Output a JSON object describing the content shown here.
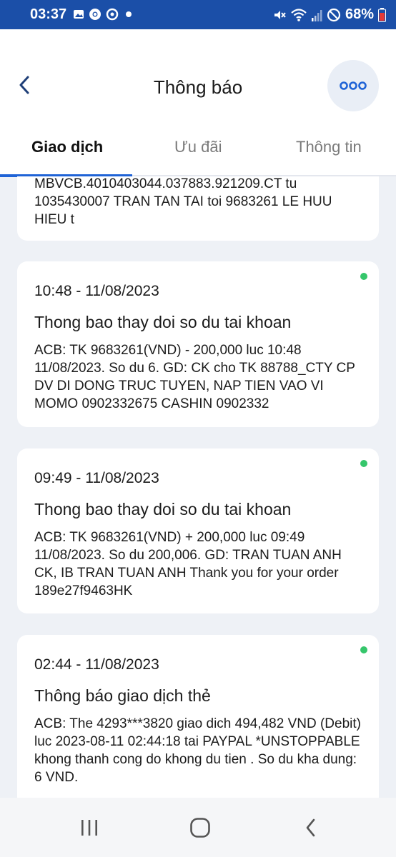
{
  "status_bar": {
    "time": "03:37",
    "battery": "68%",
    "icons_left": [
      "gallery-icon",
      "chrome-icon",
      "sync-icon",
      "dot-icon"
    ],
    "icons_right": [
      "mute-icon",
      "wifi-icon",
      "signal-icon",
      "dnd-icon",
      "battery-icon"
    ]
  },
  "header": {
    "title": "Thông báo"
  },
  "tabs": [
    {
      "label": "Giao dịch",
      "active": true
    },
    {
      "label": "Ưu đãi",
      "active": false
    },
    {
      "label": "Thông tin",
      "active": false
    }
  ],
  "notifications": [
    {
      "partial": true,
      "body": "MBVCB.4010403044.037883.921209.CT tu 1035430007 TRAN TAN TAI toi 9683261 LE HUU HIEU t"
    },
    {
      "time": "10:48 - 11/08/2023",
      "title": "Thong bao thay doi so du tai khoan",
      "body": "ACB: TK 9683261(VND) - 200,000 luc 10:48 11/08/2023. So du 6. GD: CK cho TK 88788_CTY CP DV DI DONG TRUC TUYEN, NAP TIEN VAO VI MOMO 0902332675 CASHIN 0902332",
      "unread": true
    },
    {
      "time": "09:49 - 11/08/2023",
      "title": "Thong bao thay doi so du tai khoan",
      "body": "ACB: TK 9683261(VND) + 200,000 luc 09:49 11/08/2023. So du 200,006. GD: TRAN TUAN ANH CK, IB TRAN TUAN ANH Thank you for your order 189e27f9463HK",
      "unread": true
    },
    {
      "time": "02:44 - 11/08/2023",
      "title": "Thông báo giao dịch thẻ",
      "body": "ACB: The 4293***3820 giao dich 494,482 VND (Debit) luc 2023-08-11 02:44:18 tai PAYPAL *UNSTOPPABLE khong thanh cong do khong du tien . So du kha dung: 6 VND.",
      "unread": true
    }
  ],
  "colors": {
    "status_bar": "#1b4fa8",
    "accent": "#1f63d6",
    "unread_dot": "#35c66b",
    "background": "#eef1f6"
  },
  "nav_bar": {
    "icons": [
      "recent-apps-icon",
      "home-icon",
      "back-nav-icon"
    ]
  }
}
